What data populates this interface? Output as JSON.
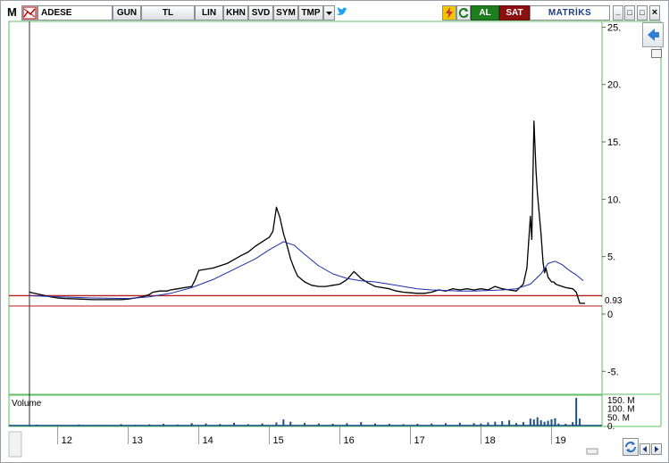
{
  "toolbar": {
    "app_logo": "M",
    "symbol": "ADESE",
    "period": "GUN",
    "currency": "TL",
    "scale": "LIN",
    "tool_khn": "KHN",
    "tool_svd": "SVD",
    "tool_sym": "SYM",
    "tool_tmp": "TMP",
    "buy_label": "AL",
    "sell_label": "SAT",
    "brand": "MATRİKS",
    "window_minimize": "_",
    "window_restore": "□",
    "window_maximize": "□",
    "window_close": "×"
  },
  "chart_data": {
    "type": "line",
    "x_axis": {
      "tick_labels": [
        "12",
        "13",
        "14",
        "15",
        "16",
        "17",
        "18",
        "19"
      ]
    },
    "y_axis": {
      "tick_labels": [
        "25.",
        "20.",
        "15.",
        "10.",
        "5.",
        "0",
        "-5."
      ],
      "ylim": [
        -7,
        25.5
      ]
    },
    "price_label": "0.93",
    "series": [
      {
        "x": [
          11.6,
          11.75,
          11.9,
          12.0,
          12.1,
          12.3,
          12.5,
          12.7,
          12.9,
          13.0,
          13.1,
          13.2,
          13.3,
          13.35,
          13.45,
          13.55,
          13.6,
          13.7,
          13.8,
          13.9,
          13.95,
          14.0,
          14.2,
          14.4,
          14.6,
          14.7,
          14.8,
          14.9,
          15.0,
          15.05,
          15.1,
          15.15,
          15.2,
          15.25,
          15.3,
          15.35,
          15.4,
          15.5,
          15.6,
          15.7,
          15.8,
          15.9,
          16.0,
          16.1,
          16.2,
          16.25,
          16.3,
          16.4,
          16.5,
          16.6,
          16.7,
          16.8,
          16.9,
          17.0,
          17.1,
          17.2,
          17.3,
          17.4,
          17.5,
          17.6,
          17.7,
          17.8,
          17.9,
          18.0,
          18.1,
          18.2,
          18.3,
          18.4,
          18.5,
          18.6,
          18.65,
          18.7,
          18.72,
          18.75,
          18.78,
          18.8,
          18.85,
          18.88,
          18.9,
          18.92,
          18.95,
          19.0,
          19.03,
          19.06,
          19.1,
          19.2,
          19.3,
          19.35,
          19.4,
          19.5
        ],
        "values": [
          1.9,
          1.7,
          1.5,
          1.4,
          1.35,
          1.3,
          1.25,
          1.25,
          1.25,
          1.3,
          1.4,
          1.5,
          1.7,
          1.9,
          2.0,
          2.0,
          2.1,
          2.2,
          2.3,
          2.4,
          3.0,
          3.8,
          4.0,
          4.4,
          5.1,
          5.4,
          5.9,
          6.3,
          6.7,
          7.2,
          9.3,
          8.4,
          7.0,
          6.0,
          4.8,
          4.0,
          3.3,
          2.8,
          2.5,
          2.4,
          2.4,
          2.5,
          2.6,
          3.0,
          3.7,
          3.4,
          3.1,
          2.7,
          2.4,
          2.3,
          2.2,
          2.0,
          1.9,
          1.85,
          1.8,
          1.8,
          1.9,
          2.1,
          2.0,
          2.2,
          2.1,
          2.2,
          2.1,
          2.2,
          2.1,
          2.4,
          2.2,
          2.1,
          2.0,
          2.6,
          4.0,
          8.5,
          6.5,
          16.8,
          12.5,
          10.5,
          7.0,
          4.5,
          3.6,
          4.0,
          3.2,
          2.8,
          2.8,
          2.6,
          2.5,
          2.3,
          2.2,
          1.9,
          0.93,
          0.93
        ]
      },
      {
        "x": [
          11.6,
          12.0,
          12.5,
          13.0,
          13.3,
          13.6,
          13.9,
          14.2,
          14.5,
          14.8,
          15.0,
          15.2,
          15.35,
          15.5,
          15.7,
          15.9,
          16.1,
          16.3,
          16.5,
          16.7,
          16.9,
          17.1,
          17.3,
          17.5,
          17.7,
          17.9,
          18.1,
          18.3,
          18.5,
          18.7,
          18.85,
          18.95,
          19.05,
          19.15,
          19.25,
          19.35,
          19.45
        ],
        "values": [
          1.6,
          1.5,
          1.4,
          1.35,
          1.5,
          1.8,
          2.3,
          3.0,
          3.9,
          4.8,
          5.6,
          6.3,
          6.0,
          5.2,
          4.2,
          3.5,
          3.1,
          2.9,
          2.8,
          2.6,
          2.4,
          2.2,
          2.1,
          2.05,
          2.0,
          2.0,
          2.05,
          2.1,
          2.2,
          2.6,
          3.5,
          4.4,
          4.6,
          4.3,
          3.8,
          3.4,
          2.9
        ]
      }
    ],
    "horizontal_lines": [
      1.6,
      0.7
    ],
    "volume": {
      "label": "Volume",
      "tick_labels": [
        "150. M",
        "100. M",
        "50. M",
        "0."
      ],
      "ylim": [
        0,
        170
      ],
      "x": [
        11.7,
        12.0,
        12.3,
        12.6,
        12.9,
        13.1,
        13.3,
        13.5,
        13.7,
        13.9,
        14.1,
        14.3,
        14.5,
        14.7,
        14.9,
        15.1,
        15.2,
        15.3,
        15.5,
        15.7,
        15.9,
        16.1,
        16.3,
        16.5,
        16.7,
        16.9,
        17.1,
        17.3,
        17.5,
        17.7,
        17.9,
        18.0,
        18.1,
        18.2,
        18.3,
        18.4,
        18.5,
        18.6,
        18.7,
        18.75,
        18.8,
        18.85,
        18.9,
        18.95,
        19.0,
        19.05,
        19.1,
        19.2,
        19.3,
        19.35,
        19.4
      ],
      "values": [
        5,
        4,
        6,
        3,
        8,
        5,
        7,
        10,
        6,
        14,
        12,
        9,
        16,
        8,
        12,
        18,
        35,
        22,
        15,
        12,
        10,
        14,
        20,
        12,
        10,
        8,
        10,
        12,
        14,
        16,
        14,
        12,
        18,
        22,
        25,
        30,
        14,
        20,
        40,
        35,
        48,
        30,
        22,
        28,
        36,
        42,
        12,
        10,
        20,
        160,
        40
      ]
    }
  }
}
